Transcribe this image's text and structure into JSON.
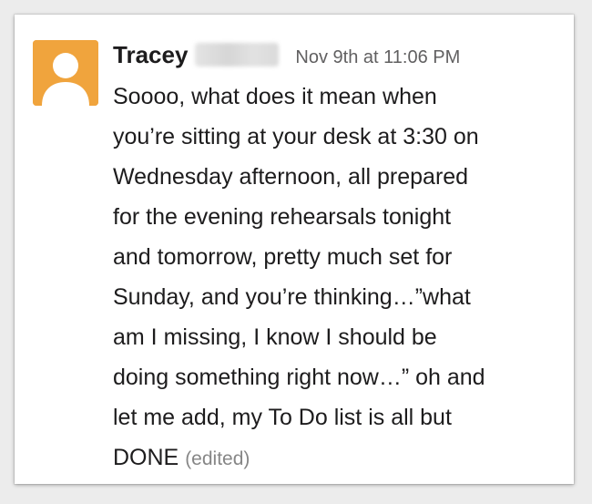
{
  "message": {
    "author": "Tracey",
    "timestamp": "Nov 9th at 11:06 PM",
    "lines": [
      "Soooo, what does it mean when",
      "you’re sitting at your desk at 3:30 on",
      "Wednesday afternoon, all prepared",
      "for the evening rehearsals tonight",
      "and tomorrow, pretty much set for",
      "Sunday, and you’re thinking…”what",
      "am I missing, I know I should be",
      "doing something right now…” oh and",
      "let me add, my To Do list is all but",
      "DONE"
    ],
    "edited_label": "(edited)"
  },
  "avatar": {
    "icon": "default-user-avatar-icon",
    "background_color": "#f0a43d"
  },
  "colors": {
    "text": "#1d1c1d",
    "timestamp": "#616061",
    "edited": "#868686"
  }
}
